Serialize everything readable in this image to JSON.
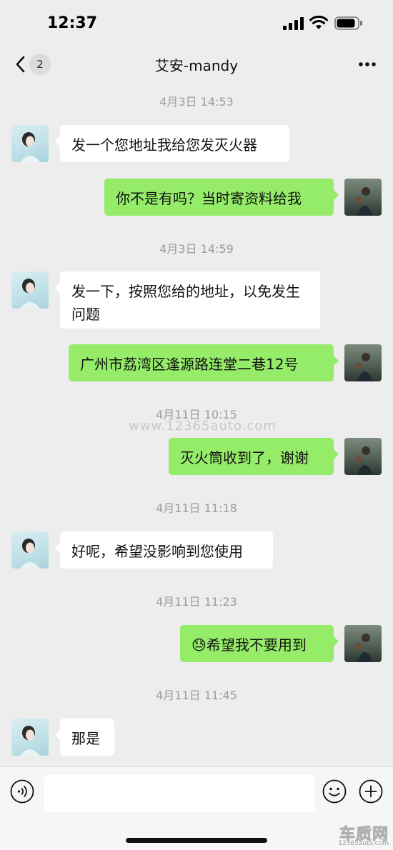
{
  "status": {
    "time": "12:37"
  },
  "header": {
    "unread_count": "2",
    "title": "艾安-mandy"
  },
  "chat": {
    "timestamps": [
      "4月3日 14:53",
      "4月3日 14:59",
      "4月11日 10:15",
      "4月11日 11:18",
      "4月11日 11:23",
      "4月11日 11:45"
    ],
    "messages": [
      {
        "side": "in",
        "text": "发一个您地址我给您发灭火器"
      },
      {
        "side": "out",
        "text": "你不是有吗？当时寄资料给我"
      },
      {
        "side": "in",
        "text": "发一下，按照您给的地址，以免发生问题"
      },
      {
        "side": "out",
        "text": "广州市荔湾区逢源路连堂二巷12号"
      },
      {
        "side": "out",
        "text": "灭火筒收到了，谢谢"
      },
      {
        "side": "in",
        "text": "好呢，希望没影响到您使用"
      },
      {
        "side": "out",
        "emoji": "😓",
        "text": "希望我不要用到"
      },
      {
        "side": "in",
        "text": "那是"
      }
    ]
  },
  "watermark": "www.12365auto.com",
  "input": {
    "value": "",
    "placeholder": ""
  },
  "logo": {
    "cn": "车质网",
    "en": "12365auto.com"
  },
  "colors": {
    "bg": "#ededed",
    "out_bubble": "#95ec69",
    "in_bubble": "#ffffff"
  },
  "icons": [
    "back-icon",
    "more-icon",
    "voice-icon",
    "emoji-icon",
    "plus-icon",
    "signal-icon",
    "wifi-icon",
    "battery-icon"
  ]
}
